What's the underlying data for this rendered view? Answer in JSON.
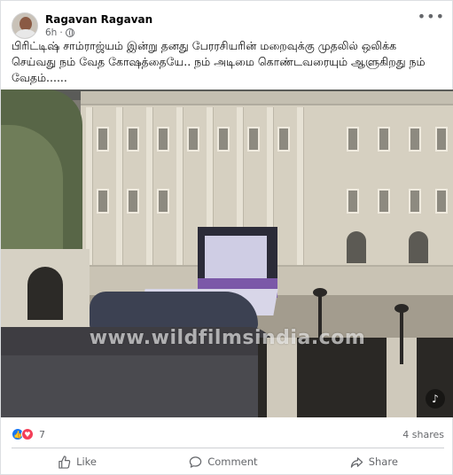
{
  "post": {
    "author": "Ragavan Ragavan",
    "time": "6h",
    "privacy_separator": "·",
    "more_icon": "more-horizontal-icon",
    "text": "பிரிட்டிஷ் சாம்ராஜ்யம் இன்று தனது பேரரசியரின் மறைவுக்கு முதலில் ஒலிக்க செய்வது நம் வேத கோஷத்தையே.. நம் அடிமை கொண்டவரையும் ஆளுகிறது நம் வேதம்......"
  },
  "media": {
    "watermark": "www.wildfilmsindia.com",
    "sound_icon": "volume-icon"
  },
  "stats": {
    "reaction_count": "7",
    "reaction_icons": [
      "like-reaction-icon",
      "love-reaction-icon"
    ],
    "shares": "4 shares"
  },
  "actions": {
    "like": "Like",
    "comment": "Comment",
    "share": "Share"
  },
  "colors": {
    "facebook_blue": "#1877f2",
    "love_red": "#f33e58",
    "secondary_text": "#65676b"
  }
}
